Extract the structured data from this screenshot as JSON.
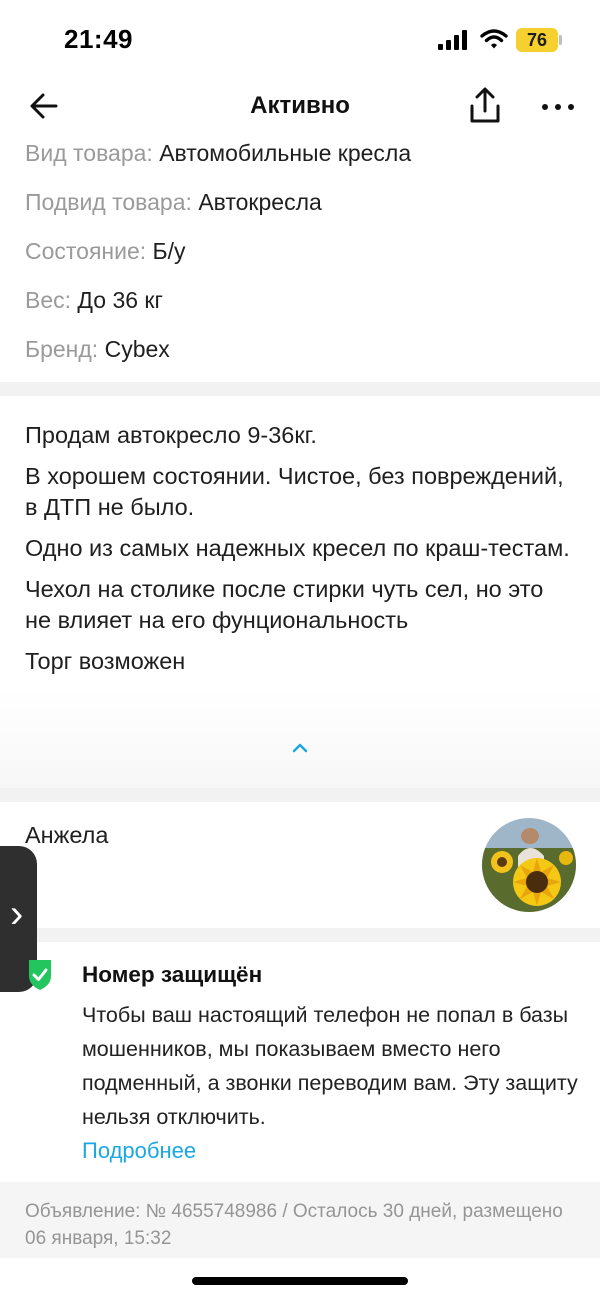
{
  "status_bar": {
    "time": "21:49",
    "battery": "76"
  },
  "nav": {
    "title": "Активно",
    "back_icon": "arrow-left-icon",
    "share_icon": "share-icon",
    "more_icon": "more-horizontal-icon"
  },
  "params": [
    {
      "label": "Вид товара:",
      "value": "Автомобильные кресла"
    },
    {
      "label": "Подвид товара:",
      "value": "Автокресла"
    },
    {
      "label": "Состояние:",
      "value": "Б/у"
    },
    {
      "label": "Вес:",
      "value": "До 36 кг"
    },
    {
      "label": "Бренд:",
      "value": "Cybex"
    }
  ],
  "description": {
    "paragraphs": [
      "Продам автокресло 9-36кг.",
      "В хорошем состоянии. Чистое, без повреждений, в ДТП не было.",
      "Одно из самых надежных кресел по краш-тестам.",
      "Чехол на столике после стирки чуть сел, но это не влияет на его фунциональность",
      "Торг возможен"
    ],
    "collapse_icon": "chevron-up-icon"
  },
  "seller": {
    "name": "Анжела",
    "avatar_icon": "avatar-sunflower"
  },
  "protection": {
    "title": "Номер защищён",
    "text": "Чтобы ваш настоящий телефон не попал в базы мошенников, мы показываем вместо него подменный, а звонки переводим вам. Эту защиту нельзя отключить.",
    "link": "Подробнее",
    "icon": "shield-check-icon"
  },
  "listing_info": "Объявление: № 4655748986 / Осталось 30 дней, размещено 06 января, 15:32",
  "colors": {
    "link": "#1ba6e6",
    "shield": "#22c55e",
    "battery": "#f5d02e"
  }
}
